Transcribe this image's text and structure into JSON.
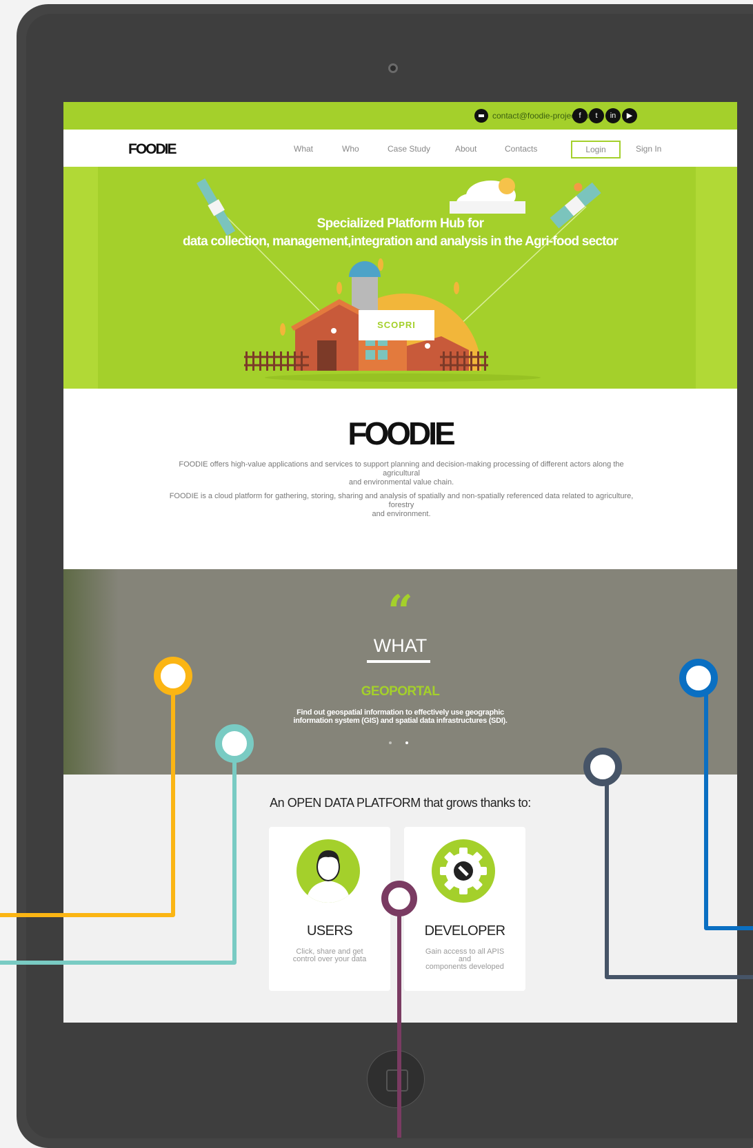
{
  "topbar": {
    "email": "contact@foodie-project.eu",
    "social_icons": [
      "facebook-icon",
      "twitter-icon",
      "linkedin-icon",
      "youtube-icon"
    ],
    "social_glyphs": [
      "f",
      "t",
      "in",
      "▶"
    ]
  },
  "nav": {
    "logo": "FOODIE",
    "items": [
      "What",
      "Who",
      "Case Study",
      "About",
      "Contacts"
    ],
    "login": "Login",
    "signin": "Sign In"
  },
  "hero": {
    "title_line1": "Specialized Platform Hub for",
    "title_line2": "data collection, management,integration and analysis in the Agri-food sector",
    "cta": "SCOPRI"
  },
  "about": {
    "logo": "FOODIE",
    "paragraph1": [
      "FOODIE offers high-value applications and services to support planning and decision-making processing of different actors along the",
      "agricultural",
      "and environmental value chain."
    ],
    "paragraph2": [
      "FOODIE is a cloud platform for gathering, storing, sharing and analysis of spatially and non-spatially referenced data related to agriculture,",
      "forestry",
      "and environment."
    ]
  },
  "what": {
    "quote_glyph": "“",
    "title": "WHAT",
    "slide_title": "GEOPORTAL",
    "slide_desc_line1": "Find out geospatial information to effectively use geographic",
    "slide_desc_line2": "information system (GIS) and spatial data infrastructures (SDI)."
  },
  "grows": {
    "title": "An OPEN DATA PLATFORM that grows thanks to:",
    "cards": [
      {
        "title": "USERS",
        "desc_line1": "Click, share and get",
        "desc_line2": "control over your data"
      },
      {
        "title": "DEVELOPER",
        "desc_line1": "Gain access to all APIS and",
        "desc_line2": "components developed"
      }
    ]
  },
  "colors": {
    "accent_green": "#a4d02b",
    "callout_yellow": "#fbb514",
    "callout_teal": "#79cbc3",
    "callout_blue": "#0a6fc2",
    "callout_slate": "#465467",
    "callout_purple": "#7a3b62"
  }
}
